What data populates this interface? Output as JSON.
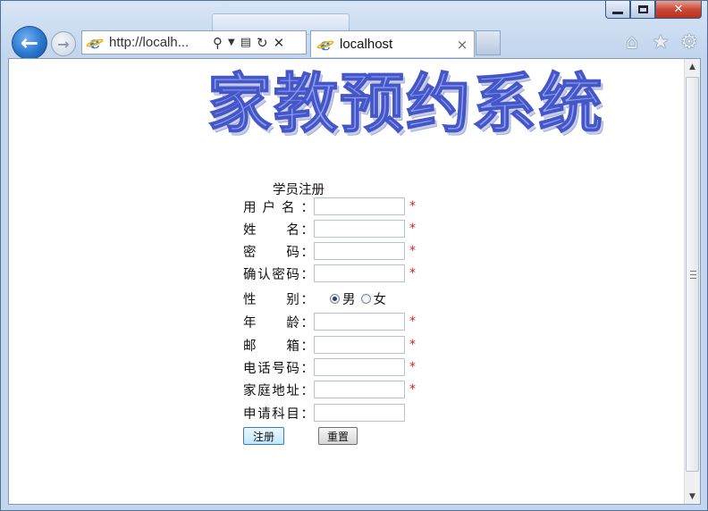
{
  "browser": {
    "address_url": "http://localh...",
    "tab_title": "localhost",
    "tab_close_glyph": "×",
    "back_glyph": "←",
    "forward_glyph": "→",
    "address_icons": [
      "search-icon",
      "dropdown-icon",
      "compatibility-icon",
      "refresh-icon",
      "stop-icon"
    ],
    "toolbar_icons": [
      "home-icon",
      "favorites-icon",
      "tools-icon"
    ]
  },
  "page": {
    "banner_title": "家教预约系统",
    "form_caption": "学员注册",
    "fields": [
      {
        "key": "username",
        "label": "用户名：",
        "type": "text",
        "value": "",
        "required": true
      },
      {
        "key": "name",
        "label": "姓　　名：",
        "type": "text",
        "value": "",
        "required": true
      },
      {
        "key": "password",
        "label": "密　　码：",
        "type": "password",
        "value": "",
        "required": true
      },
      {
        "key": "confirm_password",
        "label": "确认密码：",
        "type": "password",
        "value": "",
        "required": true
      },
      {
        "key": "gender",
        "label": "性　　别：",
        "type": "radio",
        "options": [
          "男",
          "女"
        ],
        "selected": "男",
        "required": false
      },
      {
        "key": "age",
        "label": "年　　龄：",
        "type": "text",
        "value": "",
        "required": true
      },
      {
        "key": "email",
        "label": "邮　　箱：",
        "type": "text",
        "value": "",
        "required": true
      },
      {
        "key": "phone",
        "label": "电话号码：",
        "type": "text",
        "value": "",
        "required": true
      },
      {
        "key": "address",
        "label": "家庭地址：",
        "type": "text",
        "value": "",
        "required": true
      },
      {
        "key": "subject",
        "label": "申请科目：",
        "type": "text",
        "value": "",
        "required": false
      }
    ],
    "required_mark": "*",
    "submit_label": "注册",
    "reset_label": "重置"
  },
  "colors": {
    "required": "#e02020",
    "banner_fill": "#8fa0ef",
    "banner_stroke": "#4456c8"
  }
}
